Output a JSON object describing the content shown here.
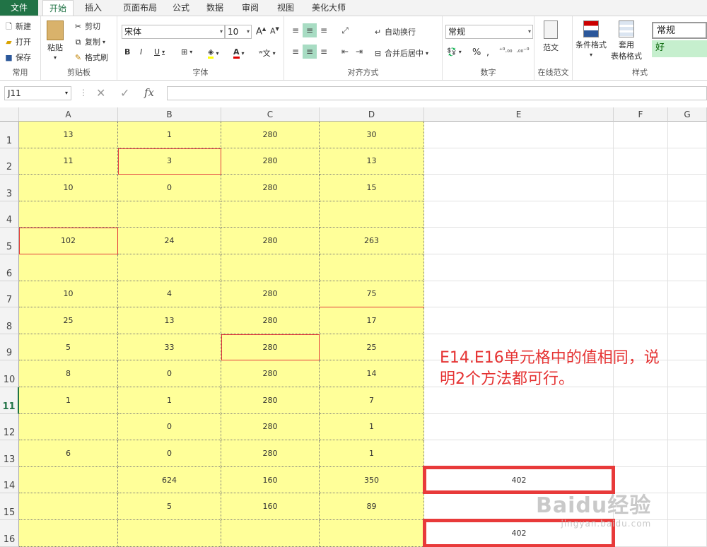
{
  "tabs": [
    "文件",
    "开始",
    "插入",
    "页面布局",
    "公式",
    "数据",
    "审阅",
    "视图",
    "美化大师"
  ],
  "ribbon": {
    "common": {
      "new": "新建",
      "open": "打开",
      "save": "保存",
      "label": "常用"
    },
    "clipboard": {
      "paste": "粘贴",
      "cut": "剪切",
      "copy": "复制",
      "format_painter": "格式刷",
      "label": "剪贴板"
    },
    "font": {
      "name": "宋体",
      "size": "10",
      "label": "字体"
    },
    "alignment": {
      "wrap": "自动换行",
      "merge": "合并后居中",
      "label": "对齐方式"
    },
    "number": {
      "format": "常规",
      "label": "数字"
    },
    "template": {
      "button": "范文",
      "label": "在线范文"
    },
    "styles": {
      "conditional": "条件格式",
      "table_format_1": "套用",
      "table_format_2": "表格格式",
      "normal": "常规",
      "good": "好",
      "label": "样式"
    }
  },
  "formula_bar": {
    "name_box": "J11",
    "fx": "fx",
    "formula": ""
  },
  "columns": [
    "A",
    "B",
    "C",
    "D",
    "E",
    "F",
    "G"
  ],
  "rows": [
    {
      "num": "1",
      "a": "13",
      "b": "1",
      "c": "280",
      "d": "30",
      "e": ""
    },
    {
      "num": "2",
      "a": "11",
      "b": "3",
      "c": "280",
      "d": "13",
      "e": ""
    },
    {
      "num": "3",
      "a": "10",
      "b": "0",
      "c": "280",
      "d": "15",
      "e": ""
    },
    {
      "num": "4",
      "a": "",
      "b": "",
      "c": "",
      "d": "",
      "e": ""
    },
    {
      "num": "5",
      "a": "102",
      "b": "24",
      "c": "280",
      "d": "263",
      "e": ""
    },
    {
      "num": "6",
      "a": "",
      "b": "",
      "c": "",
      "d": "",
      "e": ""
    },
    {
      "num": "7",
      "a": "10",
      "b": "4",
      "c": "280",
      "d": "75",
      "e": ""
    },
    {
      "num": "8",
      "a": "25",
      "b": "13",
      "c": "280",
      "d": "17",
      "e": ""
    },
    {
      "num": "9",
      "a": "5",
      "b": "33",
      "c": "280",
      "d": "25",
      "e": ""
    },
    {
      "num": "10",
      "a": "8",
      "b": "0",
      "c": "280",
      "d": "14",
      "e": ""
    },
    {
      "num": "11",
      "a": "1",
      "b": "1",
      "c": "280",
      "d": "7",
      "e": ""
    },
    {
      "num": "12",
      "a": "",
      "b": "0",
      "c": "280",
      "d": "1",
      "e": ""
    },
    {
      "num": "13",
      "a": "6",
      "b": "0",
      "c": "280",
      "d": "1",
      "e": ""
    },
    {
      "num": "14",
      "a": "",
      "b": "624",
      "c": "160",
      "d": "350",
      "e": "402"
    },
    {
      "num": "15",
      "a": "",
      "b": "5",
      "c": "160",
      "d": "89",
      "e": ""
    },
    {
      "num": "16",
      "a": "",
      "b": "",
      "c": "",
      "d": "",
      "e": "402"
    }
  ],
  "note": "E14.E16单元格中的值相同，说明2个方法都可行。",
  "colors": {
    "accent": "#217346",
    "cell_fill": "#ffff99",
    "annotation": "#e53333"
  },
  "watermark": {
    "brand": "Baidu经验",
    "url": "jingyan.baidu.com"
  }
}
